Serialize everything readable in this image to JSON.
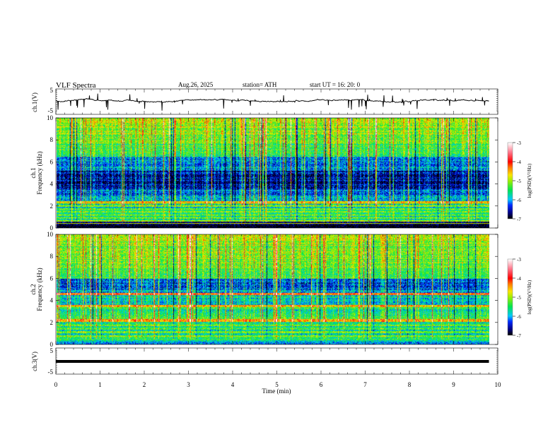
{
  "header": {
    "title": "VLF  Spectra",
    "date": "Aug.26, 2025",
    "station": "station= ATH",
    "start_ut": "start  UT  =    16: 20: 0"
  },
  "chart_data": [
    {
      "type": "line",
      "panel": "ch1-waveform",
      "ylabel": "ch.1(V)",
      "ylim": [
        -5,
        5
      ],
      "yticks": [
        "5",
        "-5"
      ],
      "xlim": [
        0,
        10
      ],
      "data_end_min": 9.8,
      "color": "#000000"
    },
    {
      "type": "heatmap",
      "panel": "ch1-spectrogram",
      "ylabel_line1": "ch.1",
      "ylabel_line2": "Frequency  (kHz)",
      "ylim": [
        0,
        10
      ],
      "yticks": [
        "0",
        "2",
        "4",
        "6",
        "8",
        "10"
      ],
      "xlim": [
        0,
        10
      ],
      "data_end_min": 9.8,
      "colorbar": {
        "label": "log(PSD)(V²/Hz)",
        "range": [
          -7,
          -3
        ],
        "ticks": [
          "-3",
          "-4",
          "-5",
          "-6",
          "-7"
        ]
      }
    },
    {
      "type": "heatmap",
      "panel": "ch2-spectrogram",
      "ylabel_line1": "ch.2",
      "ylabel_line2": "Frequency  (kHz)",
      "ylim": [
        0,
        10
      ],
      "yticks": [
        "0",
        "2",
        "4",
        "6",
        "8",
        "10"
      ],
      "xlim": [
        0,
        10
      ],
      "data_end_min": 9.8,
      "colorbar": {
        "label": "log(PSD)(V²/Hz)",
        "range": [
          -7,
          -3
        ],
        "ticks": [
          "-3",
          "-4",
          "-5",
          "-6",
          "-7"
        ]
      }
    },
    {
      "type": "line",
      "panel": "ch3-waveform",
      "ylabel": "ch.3(V)",
      "ylim": [
        -5,
        5
      ],
      "yticks": [
        "5",
        "-5"
      ],
      "xlim": [
        0,
        10
      ],
      "data_end_min": 9.8,
      "level_v": 0,
      "color": "#000000"
    }
  ],
  "xaxis": {
    "label": "Time  (min)",
    "ticks": [
      "0",
      "1",
      "2",
      "3",
      "4",
      "5",
      "6",
      "7",
      "8",
      "9",
      "10"
    ]
  }
}
